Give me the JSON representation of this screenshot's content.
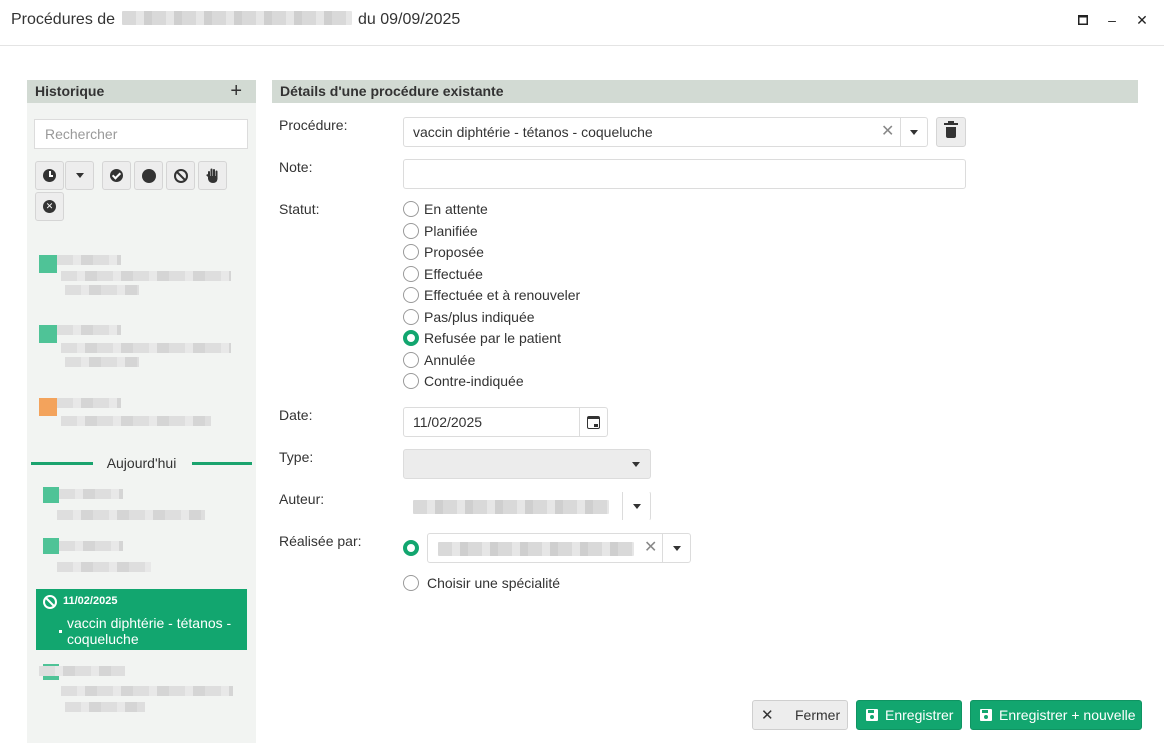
{
  "window": {
    "title_prefix": "Procédures de",
    "title_suffix": "du 09/09/2025",
    "maximize_glyph": "🗖",
    "minimize_glyph": "–",
    "close_glyph": "✕"
  },
  "sidebar": {
    "title": "Historique",
    "add_glyph": "+",
    "search_placeholder": "Rechercher",
    "today_label": "Aujourd'hui",
    "filters": [
      "clock-icon",
      "caret-down-icon",
      "check-circle-icon",
      "filled-circle-icon",
      "ban-icon",
      "hand-icon",
      "x-circle-icon"
    ],
    "selected_item": {
      "date": "11/02/2025",
      "name": "vaccin diphtérie - tétanos - coqueluche",
      "status_icon": "ban-icon"
    },
    "history_colors": [
      "#4fc397",
      "#4fc397",
      "#f3a35c",
      "#4fc397",
      "#4fc397",
      "#4fc397"
    ]
  },
  "main": {
    "header": "Détails d'une procédure existante",
    "procedure_label": "Procédure:",
    "procedure_value": "vaccin diphtérie - tétanos - coqueluche",
    "note_label": "Note:",
    "note_value": "",
    "statut_label": "Statut:",
    "statut_options": [
      "En attente",
      "Planifiée",
      "Proposée",
      "Effectuée",
      "Effectuée et à renouveler",
      "Pas/plus indiquée",
      "Refusée par le patient",
      "Annulée",
      "Contre-indiquée"
    ],
    "statut_selected": "Refusée par le patient",
    "date_label": "Date:",
    "date_value": "11/02/2025",
    "type_label": "Type:",
    "type_value": "",
    "auteur_label": "Auteur:",
    "realisee_label": "Réalisée par:",
    "choisir_specialite": "Choisir une spécialité"
  },
  "footer": {
    "close_label": "Fermer",
    "save_label": "Enregistrer",
    "save_new_label": "Enregistrer + nouvelle"
  },
  "colors": {
    "accent": "#12a66f",
    "panel_header": "#d2dad3",
    "sidebar_bg": "#f2f4f2"
  }
}
